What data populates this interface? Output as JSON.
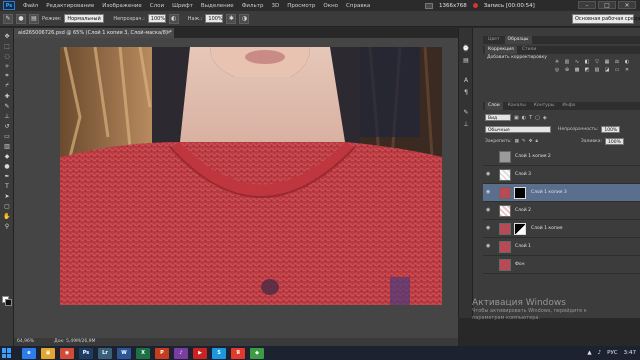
{
  "app": {
    "logo": "Ps"
  },
  "menu": [
    "Файл",
    "Редактирование",
    "Изображение",
    "Слои",
    "Шрифт",
    "Выделение",
    "Фильтр",
    "3D",
    "Просмотр",
    "Окно",
    "Справка"
  ],
  "recorder": {
    "resolution": "1366x768",
    "recording_label": "Запись [00:00:54]"
  },
  "window_controls": [
    "–",
    "□",
    "✕"
  ],
  "options": {
    "mode_label": "Режим:",
    "mode_value": "Нормальный",
    "opacity_label": "Непрозрач.:",
    "opacity_value": "100%",
    "press_label": "Наж.:",
    "press_value": "100%",
    "workspace": "Основная рабочая среда"
  },
  "document_tab": {
    "title": "aid265006726.psd @ 65% (Слой 1 копия 3, Слой-маска/8) *",
    "close": "×"
  },
  "status": {
    "zoom": "64,96%",
    "doc_size": "Док: 5,49M/26,9M"
  },
  "panel": {
    "tabs_top": [
      "Цвет",
      "Образцы"
    ],
    "tabs_adj": [
      "Коррекция",
      "Стили"
    ],
    "adj_title": "Добавить корректировку",
    "tabs_layers": [
      "Слои",
      "Каналы",
      "Контуры",
      "Инфо"
    ],
    "kind_filter": "Вид",
    "blend_mode": "Обычные",
    "opacity_label": "Непрозрачность:",
    "opacity_value": "100%",
    "lock_label": "Закрепить:",
    "fill_label": "Заливка:",
    "fill_value": "100%"
  },
  "layers": [
    {
      "name": "Слой 1 копия 2",
      "visible": false,
      "selected": false,
      "mask": false
    },
    {
      "name": "Слой 3",
      "visible": true,
      "selected": false,
      "mask": false
    },
    {
      "name": "Слой 1 копия 3",
      "visible": true,
      "selected": true,
      "mask": true
    },
    {
      "name": "Слой 2",
      "visible": true,
      "selected": false,
      "mask": false
    },
    {
      "name": "Слой 1 копия",
      "visible": true,
      "selected": false,
      "mask": true
    },
    {
      "name": "Слой 1",
      "visible": true,
      "selected": false,
      "mask": false
    },
    {
      "name": "Фон",
      "visible": false,
      "selected": false,
      "mask": false
    }
  ],
  "watermark": {
    "title": "Активация Windows",
    "line1": "Чтобы активировать Windows, перейдите к",
    "line2": "параметрам компьютера."
  },
  "taskbar": {
    "apps": [
      {
        "label": "e",
        "color": "#2b7de9"
      },
      {
        "label": "▣",
        "color": "#e2a72c"
      },
      {
        "label": "◉",
        "color": "#d24b36"
      },
      {
        "label": "Ps",
        "color": "#1d3c66"
      },
      {
        "label": "Lr",
        "color": "#3a5f7a"
      },
      {
        "label": "W",
        "color": "#2b579a"
      },
      {
        "label": "X",
        "color": "#1e7145"
      },
      {
        "label": "P",
        "color": "#c43e1c"
      },
      {
        "label": "♪",
        "color": "#7a3ea0"
      },
      {
        "label": "▶",
        "color": "#cc2222"
      },
      {
        "label": "S",
        "color": "#1b98e0"
      },
      {
        "label": "Я",
        "color": "#e23a2a"
      },
      {
        "label": "◆",
        "color": "#3d9b46"
      }
    ],
    "language": "РУС",
    "time": "3:47"
  },
  "colors": {
    "accent": "#5a6e8e",
    "foreground": "#ffffff",
    "background": "#111111"
  }
}
